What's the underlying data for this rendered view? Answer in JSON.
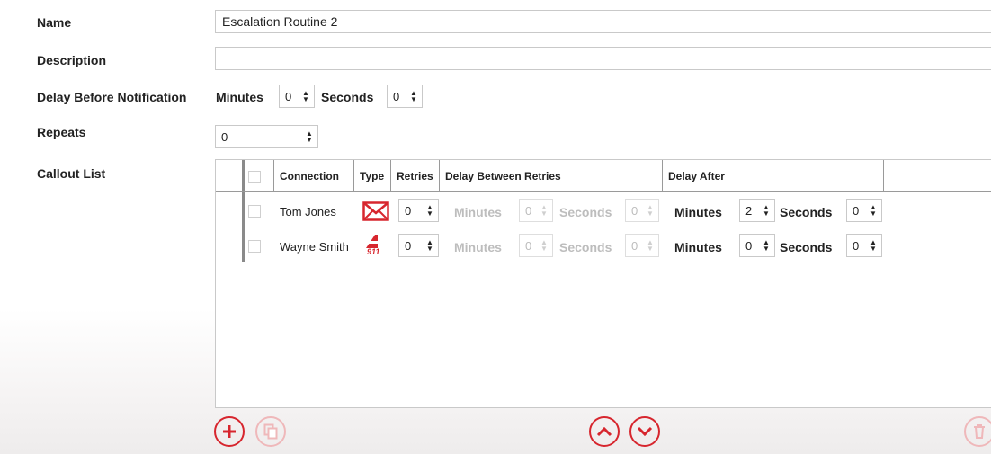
{
  "form": {
    "name_label": "Name",
    "name_value": "Escalation Routine 2",
    "description_label": "Description",
    "description_value": "",
    "delay_label": "Delay Before Notification",
    "delay_minutes_label": "Minutes",
    "delay_minutes_value": "0",
    "delay_seconds_label": "Seconds",
    "delay_seconds_value": "0",
    "repeats_label": "Repeats",
    "repeats_value": "0",
    "callout_label": "Callout List"
  },
  "grid": {
    "columns": [
      "Connection",
      "Type",
      "Retries",
      "Delay Between Retries",
      "Delay After"
    ],
    "rows": [
      {
        "connection": "Tom Jones",
        "type_icon": "envelope-icon",
        "retries": "0",
        "dbr_minutes_label": "Minutes",
        "dbr_minutes": "0",
        "dbr_seconds_label": "Seconds",
        "dbr_seconds": "0",
        "da_minutes_label": "Minutes",
        "da_minutes": "2",
        "da_seconds_label": "Seconds",
        "da_seconds": "0"
      },
      {
        "connection": "Wayne Smith",
        "type_icon": "911-phone-icon",
        "type_text": "911",
        "retries": "0",
        "dbr_minutes_label": "Minutes",
        "dbr_minutes": "0",
        "dbr_seconds_label": "Seconds",
        "dbr_seconds": "0",
        "da_minutes_label": "Minutes",
        "da_minutes": "0",
        "da_seconds_label": "Seconds",
        "da_seconds": "0"
      }
    ]
  },
  "toolbar": {
    "add_icon": "plus-icon",
    "copy_icon": "copy-icon",
    "up_icon": "chevron-up-icon",
    "down_icon": "chevron-down-icon",
    "delete_icon": "trash-icon"
  },
  "colors": {
    "accent": "#d7262e",
    "accent_disabled": "#efb8ba",
    "disabled_text": "#bdbdbd"
  }
}
